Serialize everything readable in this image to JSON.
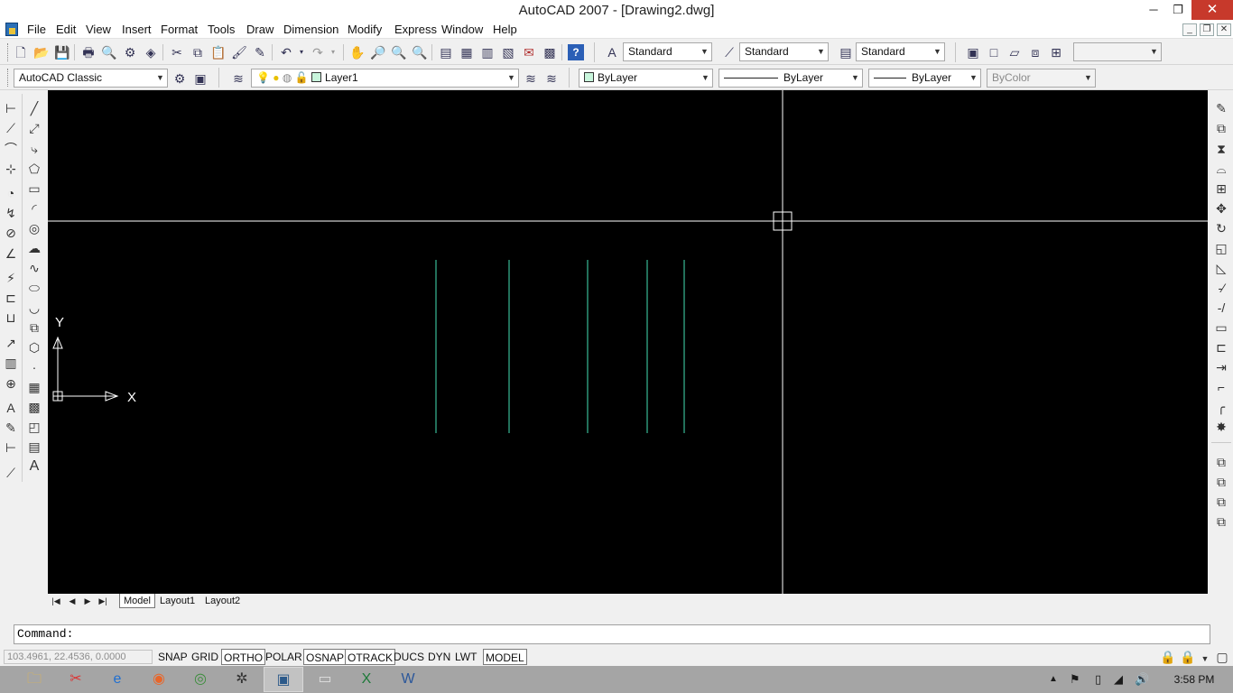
{
  "window": {
    "title": "AutoCAD 2007 - [Drawing2.dwg]",
    "minimize": "─",
    "restore": "❐",
    "close": "✕"
  },
  "menu": [
    "File",
    "Edit",
    "View",
    "Insert",
    "Format",
    "Tools",
    "Draw",
    "Dimension",
    "Modify",
    "Express",
    "Window",
    "Help"
  ],
  "mdi": {
    "minimize": "_",
    "restore": "❐",
    "close": "✕"
  },
  "styles": {
    "text_style": "Standard",
    "dim_style": "Standard",
    "table_style": "Standard"
  },
  "workspace": "AutoCAD Classic",
  "layer": "Layer1",
  "properties": {
    "color": "ByLayer",
    "linetype": "ByLayer",
    "lineweight": "ByLayer",
    "plotstyle": "ByColor"
  },
  "layout_tabs": [
    "Model",
    "Layout1",
    "Layout2"
  ],
  "active_tab": "Model",
  "command": {
    "prompt": "Command:"
  },
  "coordinates": "103.4961, 22.4536, 0.0000",
  "status_buttons": [
    "SNAP",
    "GRID",
    "ORTHO",
    "POLAR",
    "OSNAP",
    "OTRACK",
    "DUCS",
    "DYN",
    "LWT",
    "MODEL"
  ],
  "status_on": [
    "ORTHO",
    "OSNAP",
    "OTRACK",
    "MODEL"
  ],
  "ucs": {
    "x_label": "X",
    "y_label": "Y"
  },
  "clock": "3:58 PM",
  "colors": {
    "canvas": "#000000",
    "crosshair": "#ffffff",
    "line": "#44e0b4",
    "taskbar": "#a5a5a5"
  },
  "icons": {
    "taskbar": [
      "file-explorer-icon",
      "snipping-tool-icon",
      "ie-icon",
      "firefox-icon",
      "chrome-icon",
      "network-icon",
      "autocad-icon",
      "app-window-icon",
      "excel-icon",
      "word-icon"
    ],
    "tray": [
      "chevron-up-icon",
      "flag-icon",
      "battery-icon",
      "signal-icon",
      "volume-icon"
    ]
  }
}
